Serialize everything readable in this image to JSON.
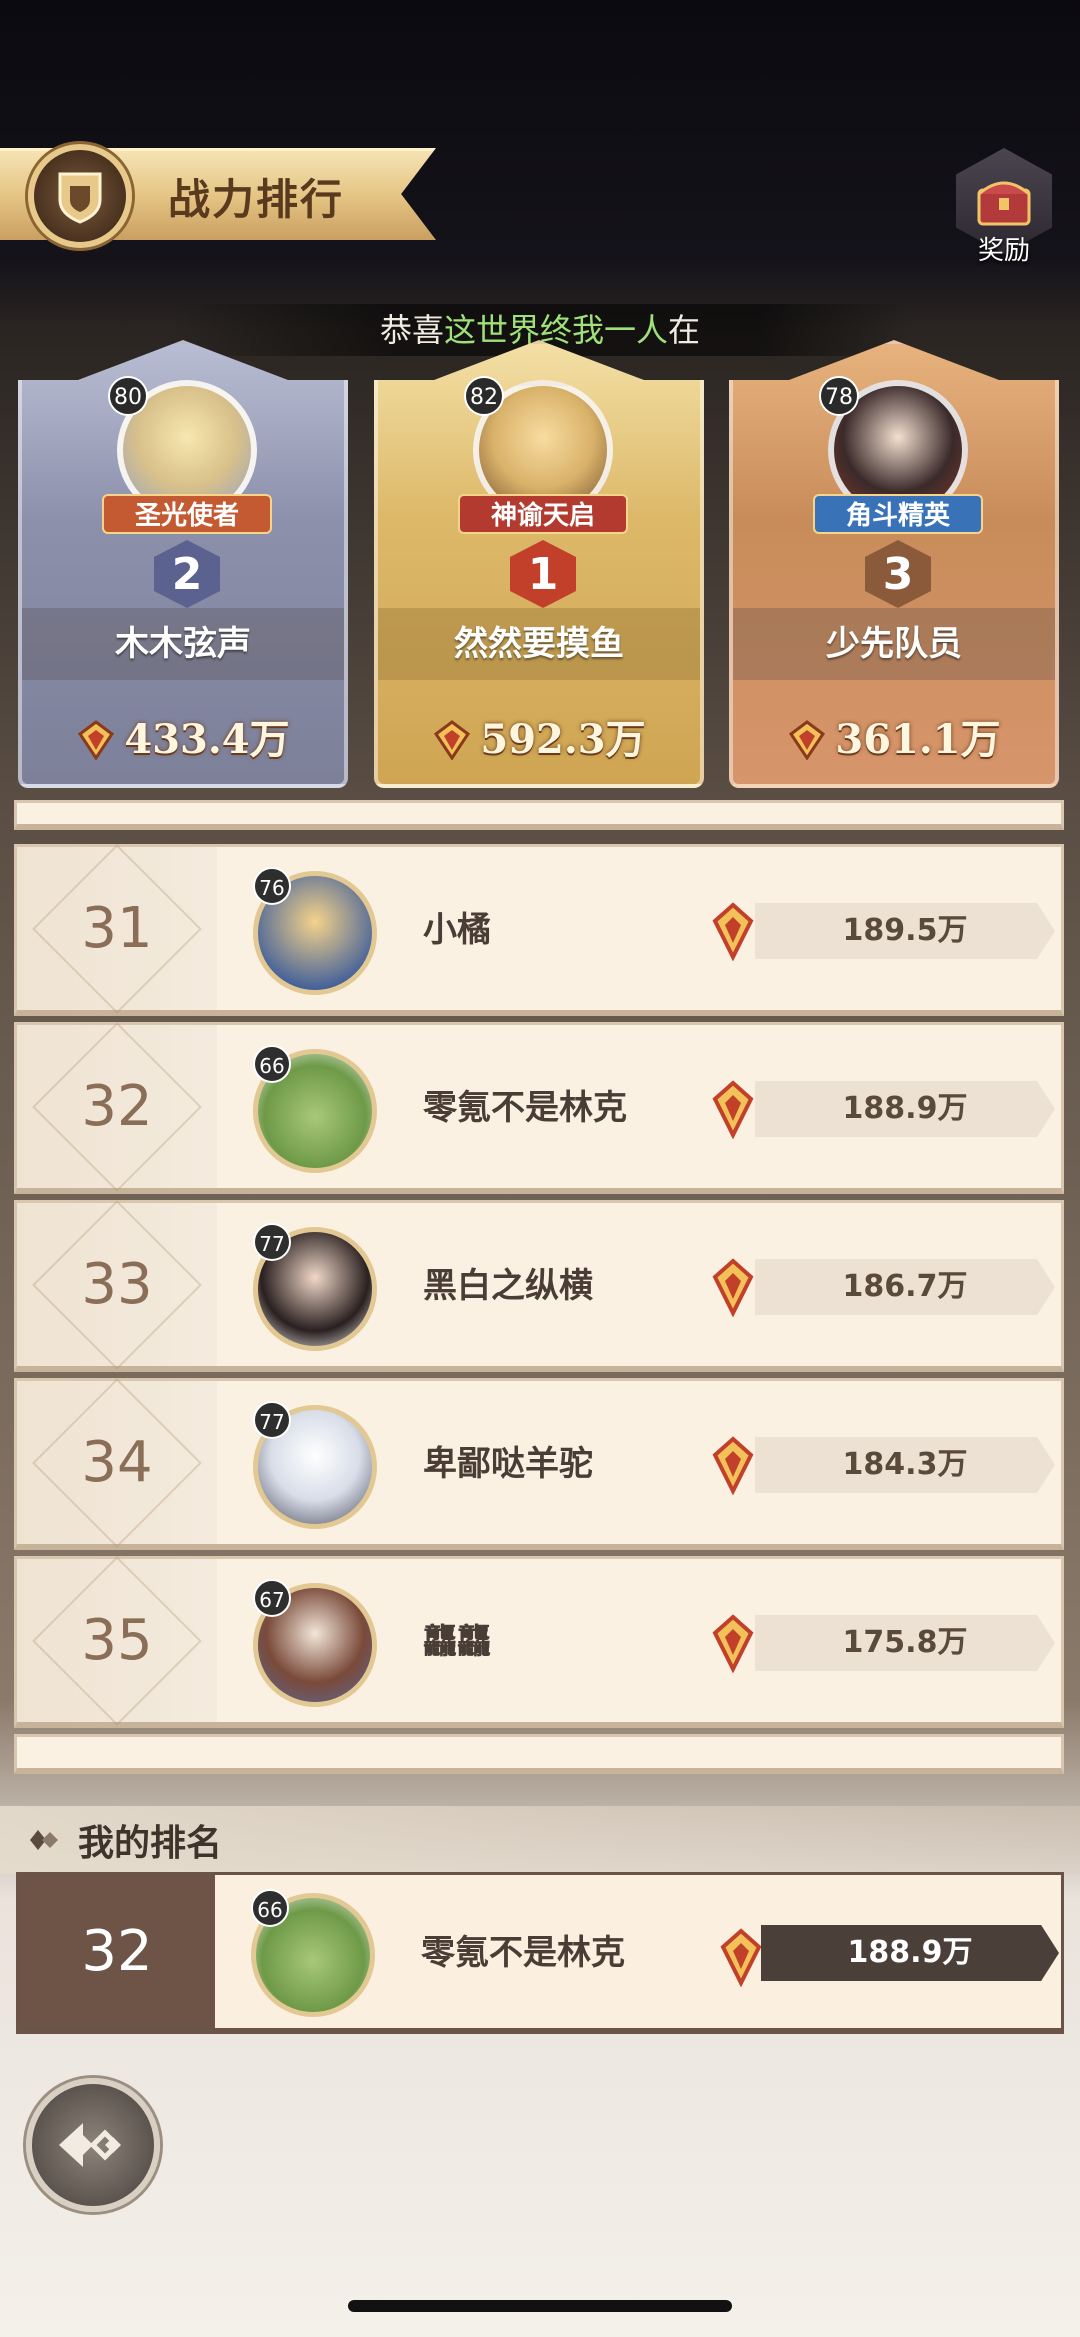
{
  "header": {
    "title": "战力排行",
    "reward_label": "奖励"
  },
  "ticker": {
    "prefix": "恭喜",
    "highlight": "这世界终我一人",
    "suffix": "在"
  },
  "podium": [
    {
      "rank": "2",
      "level": "80",
      "title": "圣光使者",
      "name": "木木弦声",
      "power": "433.4万",
      "title_color": "#c45a32"
    },
    {
      "rank": "1",
      "level": "82",
      "title": "神谕天启",
      "name": "然然要摸鱼",
      "power": "592.3万",
      "title_color": "#b23a2e"
    },
    {
      "rank": "3",
      "level": "78",
      "title": "角斗精英",
      "name": "少先队员",
      "power": "361.1万",
      "title_color": "#3a72b8"
    }
  ],
  "list": [
    {
      "rank": "31",
      "level": "76",
      "name": "小橘",
      "power": "189.5万"
    },
    {
      "rank": "32",
      "level": "66",
      "name": "零氪不是林克",
      "power": "188.9万"
    },
    {
      "rank": "33",
      "level": "77",
      "name": "黑白之纵横",
      "power": "186.7万"
    },
    {
      "rank": "34",
      "level": "77",
      "name": "卑鄙哒羊驼",
      "power": "184.3万"
    },
    {
      "rank": "35",
      "level": "67",
      "name": "龘龘",
      "power": "175.8万"
    }
  ],
  "my_rank": {
    "label": "我的排名",
    "rank": "32",
    "level": "66",
    "name": "零氪不是林克",
    "power": "188.9万"
  },
  "colors": {
    "gold": "#dcb868",
    "silver": "#8c90ab",
    "bronze": "#c88c5a",
    "row_bg": "#fbf1e3",
    "my_rank_bg": "#6e5447"
  }
}
